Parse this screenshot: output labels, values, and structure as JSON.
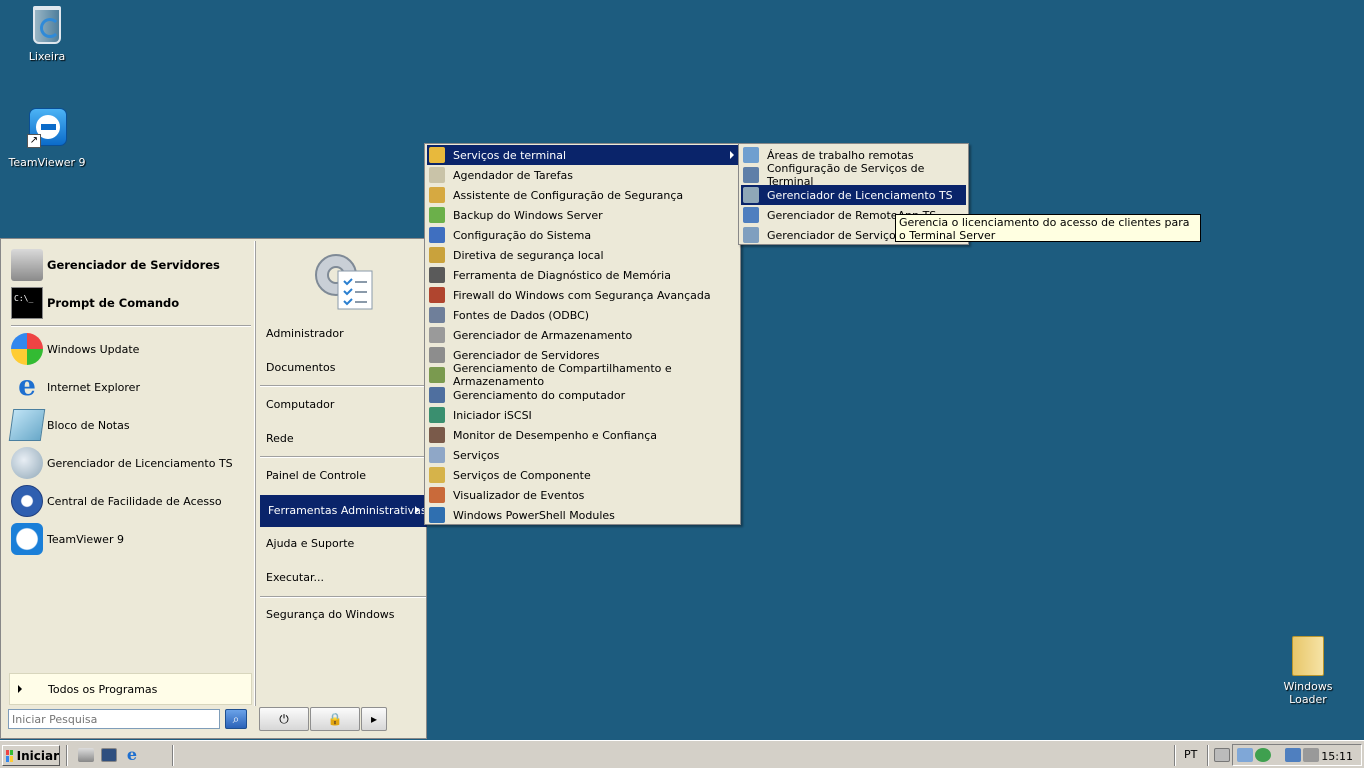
{
  "desktop": {
    "icons": [
      {
        "label": "Lixeira",
        "icon": "recycle-bin-icon"
      },
      {
        "label": "TeamViewer 9",
        "icon": "teamviewer-icon"
      },
      {
        "label": "Windows Loader",
        "icon": "folder-icon"
      }
    ]
  },
  "start_menu": {
    "pinned": [
      {
        "label": "Gerenciador de Servidores",
        "icon": "server-manager-icon",
        "bold": true
      },
      {
        "label": "Prompt de Comando",
        "icon": "command-prompt-icon",
        "bold": true
      }
    ],
    "recent": [
      {
        "label": "Windows Update",
        "icon": "windows-update-icon"
      },
      {
        "label": "Internet Explorer",
        "icon": "internet-explorer-icon"
      },
      {
        "label": "Bloco de Notas",
        "icon": "notepad-icon"
      },
      {
        "label": "Gerenciador de Licenciamento TS",
        "icon": "ts-licensing-icon"
      },
      {
        "label": "Central de Facilidade de Acesso",
        "icon": "ease-of-access-icon"
      },
      {
        "label": "TeamViewer 9",
        "icon": "teamviewer-icon"
      }
    ],
    "all_programs": "Todos os Programas",
    "search_placeholder": "Iniciar Pesquisa",
    "right_links": [
      "Administrador",
      "Documentos",
      "Computador",
      "Rede",
      "Painel de Controle",
      "Ferramentas Administrativas",
      "Ajuda e Suporte",
      "Executar...",
      "Segurança do Windows"
    ],
    "highlighted_link": "Ferramentas Administrativas"
  },
  "admin_tools_menu": [
    {
      "label": "Serviços de terminal",
      "color": "#e8b93c",
      "highlighted": true,
      "submenu": true
    },
    {
      "label": "Agendador de Tarefas",
      "color": "#c9c3a8"
    },
    {
      "label": "Assistente de Configuração de Segurança",
      "color": "#d6a941"
    },
    {
      "label": "Backup do Windows Server",
      "color": "#6bb04a"
    },
    {
      "label": "Configuração do Sistema",
      "color": "#3f6fc0"
    },
    {
      "label": "Diretiva de segurança local",
      "color": "#c9a23c"
    },
    {
      "label": "Ferramenta de Diagnóstico de Memória",
      "color": "#5a5a5a"
    },
    {
      "label": "Firewall do Windows com Segurança Avançada",
      "color": "#b0452f"
    },
    {
      "label": "Fontes de Dados (ODBC)",
      "color": "#6f7f9a"
    },
    {
      "label": "Gerenciador de Armazenamento",
      "color": "#9a9a9a"
    },
    {
      "label": "Gerenciador de Servidores",
      "color": "#8d8d8d"
    },
    {
      "label": "Gerenciamento de Compartilhamento e Armazenamento",
      "color": "#7a9a4f"
    },
    {
      "label": "Gerenciamento do computador",
      "color": "#4f6f9f"
    },
    {
      "label": "Iniciador iSCSI",
      "color": "#3a8f6f"
    },
    {
      "label": "Monitor de Desempenho e Confiança",
      "color": "#7a5a4a"
    },
    {
      "label": "Serviços",
      "color": "#8fa7c7"
    },
    {
      "label": "Serviços de Componente",
      "color": "#d6b34a"
    },
    {
      "label": "Visualizador de Eventos",
      "color": "#c96a3a"
    },
    {
      "label": "Windows PowerShell Modules",
      "color": "#2f6fb0"
    }
  ],
  "terminal_services_menu": [
    {
      "label": "Áreas de trabalho remotas",
      "color": "#6f9fcf"
    },
    {
      "label": "Configuração de Serviços de Terminal",
      "color": "#5f7fa8"
    },
    {
      "label": "Gerenciador de Licenciamento TS",
      "color": "#8fa7b7",
      "highlighted": true
    },
    {
      "label": "Gerenciador de RemoteApp TS",
      "color": "#4f7fbf"
    },
    {
      "label": "Gerenciador de Serviços de",
      "color": "#7f9fbf"
    }
  ],
  "tooltip": "Gerencia o licenciamento do acesso de clientes para o Terminal Server",
  "taskbar": {
    "start_label": "Iniciar",
    "language": "PT",
    "clock": "15:11"
  },
  "colors": {
    "desktop": "#1d5c7f",
    "highlight": "#0a246a",
    "menu_bg": "#ece9d8"
  }
}
